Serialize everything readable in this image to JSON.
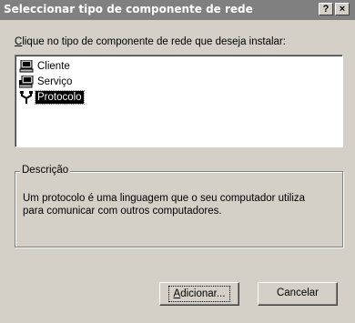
{
  "window": {
    "title": "Seleccionar tipo de componente de rede",
    "help_label": "?",
    "close_label": "×"
  },
  "prompt": {
    "accel": "C",
    "rest": "lique no tipo de componente de rede que deseja instalar:"
  },
  "components": [
    {
      "label": "Cliente",
      "icon": "client-computer-icon",
      "selected": false
    },
    {
      "label": "Serviço",
      "icon": "service-computer-icon",
      "selected": false
    },
    {
      "label": "Protocolo",
      "icon": "protocol-network-icon",
      "selected": true
    }
  ],
  "description": {
    "legend": "Descrição",
    "text": "Um protocolo é uma linguagem que o seu computador utiliza para comunicar com outros computadores."
  },
  "buttons": {
    "add_accel": "A",
    "add_rest": "dicionar...",
    "cancel": "Cancelar"
  },
  "colors": {
    "dialog_face": "#d4d0c8",
    "titlebar_inactive": "#808080",
    "selection": "#000000"
  }
}
